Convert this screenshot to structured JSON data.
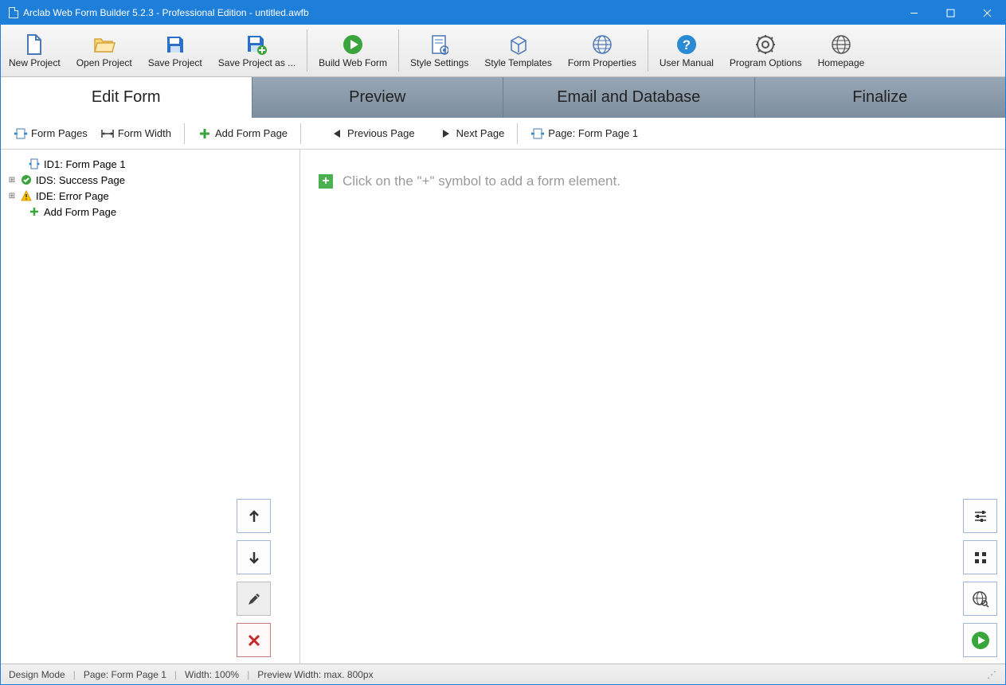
{
  "window": {
    "title": "Arclab Web Form Builder 5.2.3 - Professional Edition - untitled.awfb"
  },
  "toolbar": {
    "new_project": "New Project",
    "open_project": "Open Project",
    "save_project": "Save Project",
    "save_project_as": "Save Project as ...",
    "build_web_form": "Build Web Form",
    "style_settings": "Style Settings",
    "style_templates": "Style Templates",
    "form_properties": "Form Properties",
    "user_manual": "User Manual",
    "program_options": "Program Options",
    "homepage": "Homepage"
  },
  "tabs": {
    "edit_form": "Edit Form",
    "preview": "Preview",
    "email_database": "Email and Database",
    "finalize": "Finalize"
  },
  "subbar": {
    "form_pages": "Form Pages",
    "form_width": "Form Width",
    "add_form_page": "Add Form Page",
    "previous_page": "Previous Page",
    "next_page": "Next Page",
    "page_label": "Page: Form Page 1"
  },
  "tree": {
    "items": [
      {
        "label": "ID1: Form Page 1"
      },
      {
        "label": "IDS: Success Page"
      },
      {
        "label": "IDE: Error Page"
      },
      {
        "label": "Add Form Page"
      }
    ]
  },
  "canvas": {
    "hint": "Click on the \"+\" symbol to add a form element."
  },
  "status": {
    "mode": "Design Mode",
    "page": "Page: Form Page 1",
    "width": "Width: 100%",
    "preview_width": "Preview Width: max. 800px"
  }
}
